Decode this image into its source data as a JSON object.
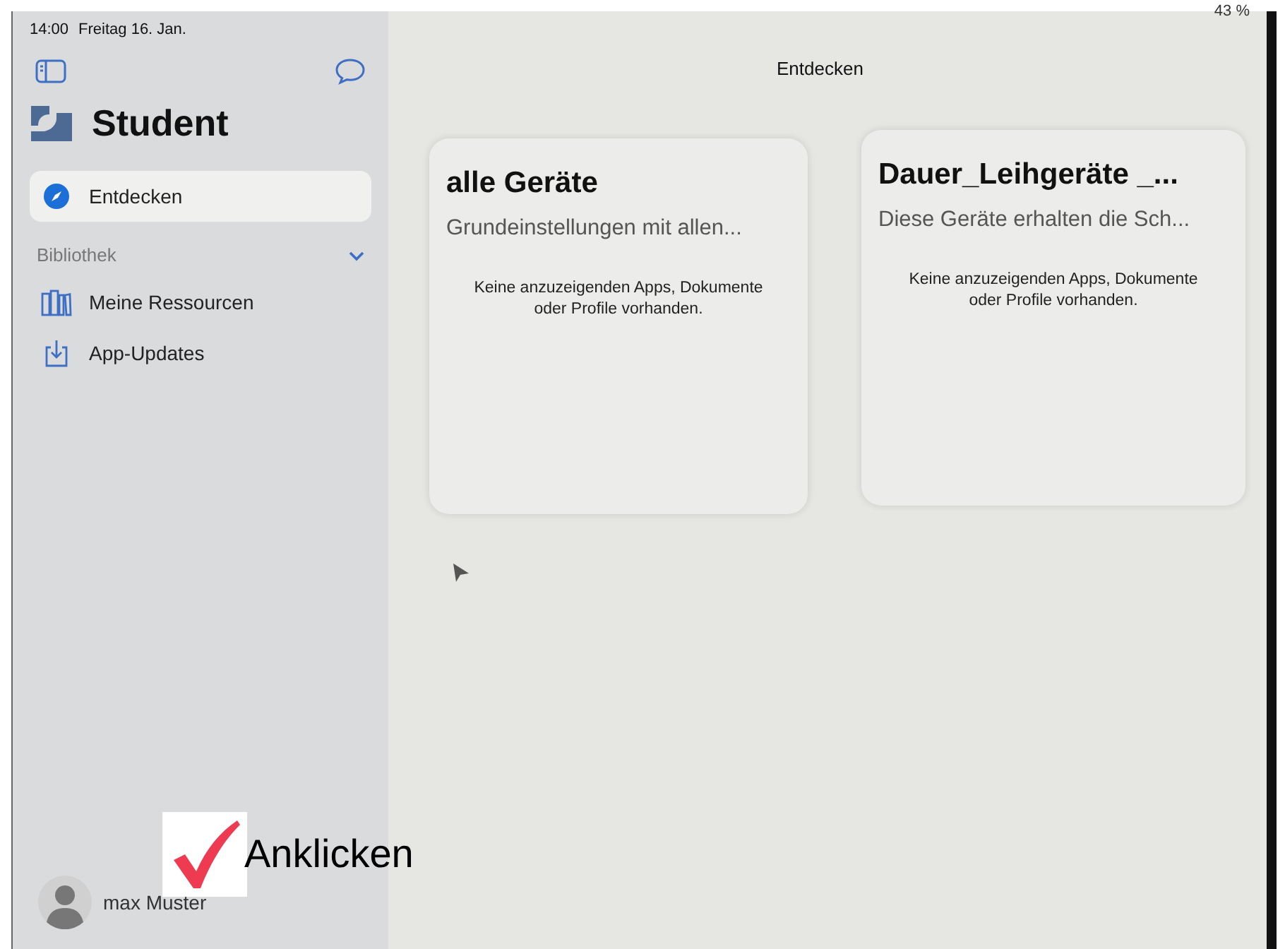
{
  "status_bar": {
    "time": "14:00",
    "date": "Freitag 16. Jan.",
    "battery": "43 %"
  },
  "sidebar": {
    "title": "Student",
    "items": [
      {
        "label": "Entdecken",
        "selected": true
      }
    ],
    "section": {
      "label": "Bibliothek",
      "expanded": true,
      "items": [
        {
          "label": "Meine Ressourcen",
          "selected": false
        },
        {
          "label": "App-Updates",
          "selected": false
        }
      ]
    },
    "user": {
      "name": "max Muster"
    }
  },
  "main": {
    "title": "Entdecken",
    "cards": [
      {
        "title": "alle Geräte",
        "subtitle": "Grundeinstellungen mit allen...",
        "message": "Keine anzuzeigenden Apps, Dokumente oder Profile vorhanden."
      },
      {
        "title": "Dauer_Leihgeräte _...",
        "subtitle": "Diese Geräte erhalten die Sch...",
        "message": "Keine anzuzeigenden Apps, Dokumente oder Profile vorhanden."
      }
    ]
  },
  "annotation": {
    "label": "Anklicken"
  }
}
